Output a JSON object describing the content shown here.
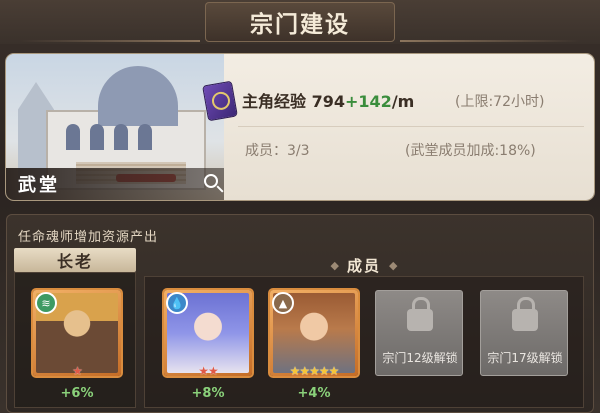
{
  "header": {
    "title": "宗门建设"
  },
  "hall": {
    "name": "武堂",
    "exp_label": "主角经验",
    "exp_base": "794",
    "exp_inc": "+142",
    "exp_unit": "/m",
    "limit": "(上限:72小时)",
    "members": "成员：3/3",
    "bonus": "(武堂成员加成:18%)",
    "icons": {
      "book": "exp-book-icon",
      "magnify": "magnifier-icon"
    }
  },
  "lower": {
    "hint": "任命魂师增加资源产出",
    "elder_title": "长老",
    "member_title": "成员",
    "elder": {
      "stars": "★",
      "stars_color": "red",
      "bonus": "+6%",
      "badge": "green"
    },
    "members": [
      {
        "stars": "★★",
        "stars_color": "red",
        "bonus": "+8%",
        "badge": "blue"
      },
      {
        "stars": "★★★★★",
        "stars_color": "gold",
        "bonus": "+4%",
        "badge": "brown"
      }
    ],
    "locked": [
      "宗门12级解锁",
      "宗门17级解锁"
    ]
  }
}
